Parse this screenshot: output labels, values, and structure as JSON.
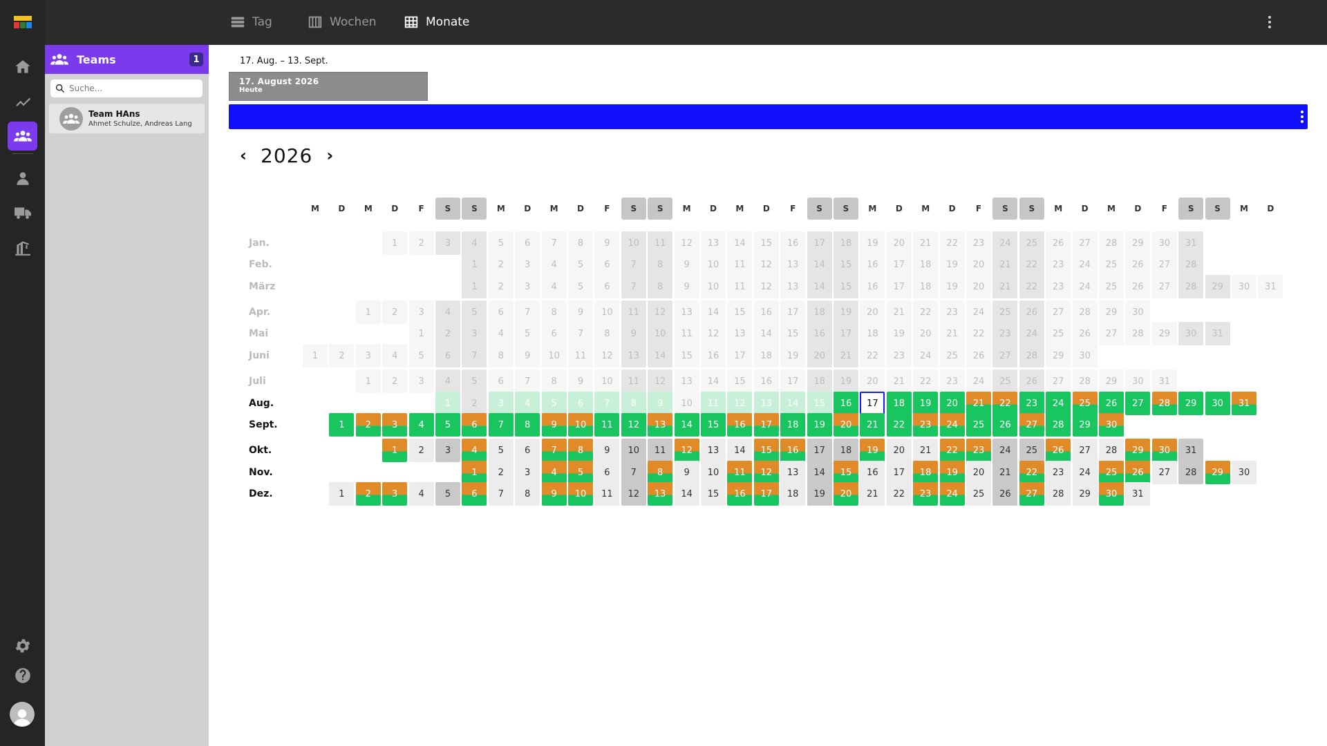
{
  "app": {
    "logo_icon": "app-logo-icon",
    "nav": [
      {
        "id": "home",
        "icon": "home-icon",
        "active": false
      },
      {
        "id": "stats",
        "icon": "chart-line-icon",
        "active": false
      },
      {
        "id": "teams",
        "icon": "team-icon",
        "active": true
      },
      {
        "id": "user",
        "icon": "user-icon",
        "active": false
      },
      {
        "id": "truck",
        "icon": "truck-icon",
        "active": false
      },
      {
        "id": "crane",
        "icon": "crane-icon",
        "active": false
      }
    ],
    "bottom_nav": [
      {
        "id": "settings",
        "icon": "gear-icon"
      },
      {
        "id": "help",
        "icon": "help-icon"
      }
    ],
    "accent": "#7c3aed",
    "primary_blue": "#1010ff"
  },
  "topbar": {
    "views": [
      {
        "id": "day",
        "label": "Tag",
        "icon": "list-icon",
        "active": false
      },
      {
        "id": "weeks",
        "label": "Wochen",
        "icon": "columns-icon",
        "active": false
      },
      {
        "id": "months",
        "label": "Monate",
        "icon": "grid-icon",
        "active": true
      }
    ],
    "add_label": "+"
  },
  "teams_panel": {
    "title": "Teams",
    "count": "1",
    "search_placeholder": "Suche...",
    "teams": [
      {
        "name": "Team HAns",
        "members": "Ahmet Schulze, Andreas Lang"
      }
    ]
  },
  "main": {
    "range": "17. Aug. – 13. Sept.",
    "today_title": "17. August 2026",
    "today_sub": "Heute",
    "year": "2026",
    "prev_label": "‹",
    "next_label": "›"
  },
  "calendar": {
    "weekday_headers": [
      "M",
      "D",
      "M",
      "D",
      "F",
      "S",
      "S",
      "M",
      "D",
      "M",
      "D",
      "F",
      "S",
      "S",
      "M",
      "D",
      "M",
      "D",
      "F",
      "S",
      "S",
      "M",
      "D",
      "M",
      "D",
      "F",
      "S",
      "S",
      "M",
      "D",
      "M",
      "D",
      "F",
      "S",
      "S",
      "M",
      "D"
    ],
    "today_month": 8,
    "today_day": 17,
    "status_colors": {
      "green": "#18c55f",
      "orange": "#e08a28",
      "weekend": "#c9c9c9",
      "empty": "#ececec"
    },
    "months": [
      {
        "label": "Jan.",
        "offset": 3,
        "days": 31,
        "past": true,
        "status": "-----------------------------"
      },
      {
        "label": "Feb.",
        "offset": 6,
        "days": 28,
        "past": true,
        "status": "----------------------------"
      },
      {
        "label": "März",
        "offset": 6,
        "days": 31,
        "past": true,
        "status": "-------------------------------"
      },
      {
        "label": "Apr.",
        "offset": 2,
        "days": 30,
        "past": true,
        "status": "------------------------------"
      },
      {
        "label": "Mai",
        "offset": 4,
        "days": 31,
        "past": true,
        "status": "-------------------------------"
      },
      {
        "label": "Juni",
        "offset": 0,
        "days": 30,
        "past": true,
        "status": "------------------------------"
      },
      {
        "label": "Juli",
        "offset": 2,
        "days": 31,
        "past": true,
        "status": "-------------------------------"
      },
      {
        "label": "Aug.",
        "offset": 5,
        "days": 31,
        "past": false,
        "status": "g-ggggggg-gggggGoGGGOOGGOGGOGGOG"
      },
      {
        "label": "Sept.",
        "offset": 1,
        "days": 30,
        "past": false,
        "status": "GOOGGOGGOOGGOGGOOGGOGGOOGGOGGO"
      },
      {
        "label": "Okt.",
        "offset": 3,
        "days": 31,
        "past": false,
        "status": "O--O--OO---O--OO--O--OO--O--OO--"
      },
      {
        "label": "Nov.",
        "offset": 6,
        "days": 30,
        "past": false,
        "status": "O--OO--O--OO--O--OO--O--OO--O-"
      },
      {
        "label": "Dez.",
        "offset": 1,
        "days": 31,
        "past": false,
        "status": "-OO--O--OO--O--OO--O--OO--O--O-"
      }
    ]
  }
}
